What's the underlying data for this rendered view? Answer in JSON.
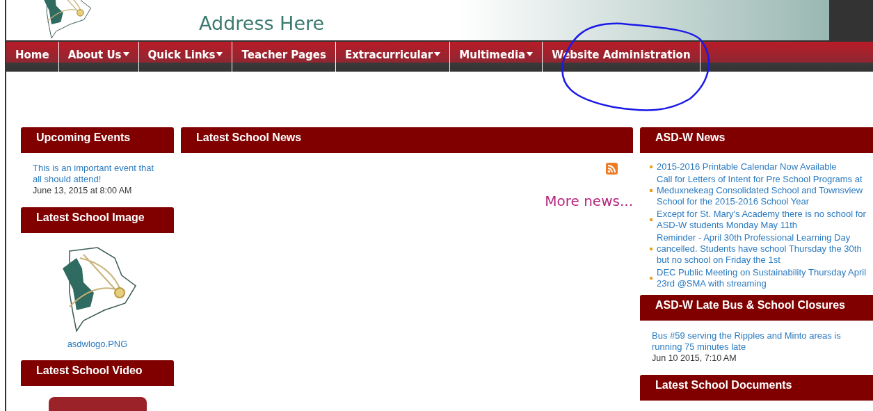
{
  "header": {
    "address": "Address Here"
  },
  "nav": [
    {
      "label": "Home",
      "dropdown": false
    },
    {
      "label": "About Us",
      "dropdown": true
    },
    {
      "label": "Quick Links",
      "dropdown": true
    },
    {
      "label": "Teacher Pages",
      "dropdown": false
    },
    {
      "label": "Extracurricular",
      "dropdown": true
    },
    {
      "label": "Multimedia",
      "dropdown": true
    },
    {
      "label": "Website Administration",
      "dropdown": false
    }
  ],
  "left": {
    "events_title": "Upcoming Events",
    "event": {
      "title": "This is an important event that all should attend!",
      "date": "June 13, 2015 at 8:00 AM"
    },
    "image_title": "Latest School Image",
    "image_caption": "asdwlogo.PNG",
    "video_title": "Latest School Video"
  },
  "middle": {
    "title": "Latest School News",
    "more": "More news..."
  },
  "right": {
    "news_title": "ASD-W News",
    "news": [
      "2015-2016 Printable Calendar Now Available",
      "Call for Letters of Intent for Pre School Programs at Meduxnekeag Consolidated School and Townsview School for the 2015-2016 School Year",
      "Except for St. Mary's Academy there is no school for ASD-W students Monday May 11th",
      "Reminder - April 30th Professional Learning Day cancelled. Students have school Thursday the 30th but no school on Friday the 1st",
      "DEC Public Meeting on Sustainability Thursday April 23rd @SMA with streaming"
    ],
    "bus_title": "ASD-W Late Bus & School Closures",
    "bus": {
      "text": "Bus #59 serving the Ripples and Minto areas is running 75 minutes late",
      "date": "Jun 10 2015, 7:10 AM"
    },
    "docs_title": "Latest School Documents"
  }
}
